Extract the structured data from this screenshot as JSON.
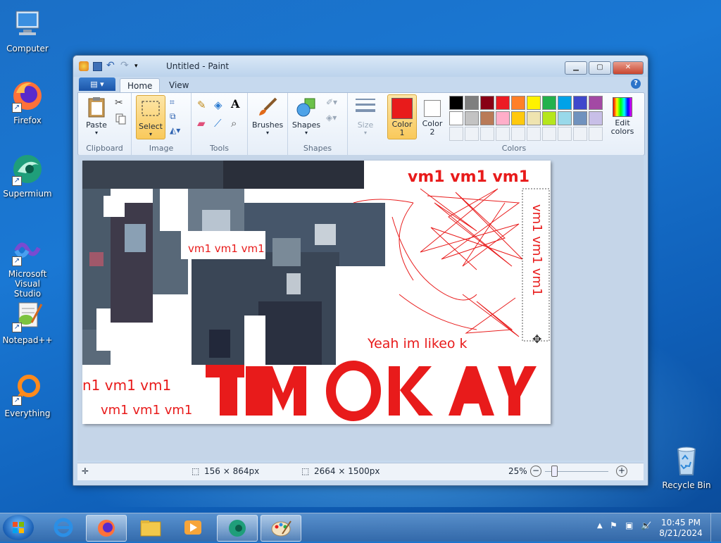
{
  "desktop": {
    "icons": [
      {
        "label": "Computer"
      },
      {
        "label": "Firefox"
      },
      {
        "label": "Supermium"
      },
      {
        "label": "Microsoft Visual Studio"
      },
      {
        "label": "Notepad++"
      },
      {
        "label": "Everything"
      },
      {
        "label": "Recycle Bin"
      }
    ]
  },
  "window": {
    "title": "Untitled - Paint",
    "tabs": {
      "home": "Home",
      "view": "View"
    },
    "help": "?"
  },
  "ribbon": {
    "clipboard": {
      "label": "Clipboard",
      "paste": "Paste"
    },
    "image": {
      "label": "Image",
      "select": "Select"
    },
    "tools": {
      "label": "Tools"
    },
    "brushes": "Brushes",
    "shapes": {
      "label": "Shapes",
      "shapes_btn": "Shapes"
    },
    "size": "Size",
    "colors": {
      "label": "Colors",
      "color1": "Color\n1",
      "color2": "Color\n2",
      "edit": "Edit\ncolors",
      "color1_value": "#e81b1b",
      "color2_value": "#ffffff",
      "palette_row1": [
        "#000000",
        "#7f7f7f",
        "#880015",
        "#ed1c24",
        "#ff7f27",
        "#fff200",
        "#22b14c",
        "#00a2e8",
        "#3f48cc",
        "#a349a4"
      ],
      "palette_row2": [
        "#ffffff",
        "#c3c3c3",
        "#b97a57",
        "#ffaec9",
        "#ffc90e",
        "#efe4b0",
        "#b5e61d",
        "#99d9ea",
        "#7092be",
        "#c8bfe7"
      ]
    }
  },
  "canvas": {
    "texts": {
      "vm_top": "vm1 vm1 vm1",
      "vm_mid": "vm1 vm1 vm1",
      "vm_vertical": "vm1 vm1 vm1",
      "yeah": "Yeah im likeo k",
      "vm_left1": "n1 vm1 vm1",
      "vm_left2": "vm1 vm1 vm1",
      "big": "IM OKAY"
    }
  },
  "status": {
    "selection": "156 × 864px",
    "image_size": "2664 × 1500px",
    "zoom": "25%"
  },
  "taskbar": {
    "time": "10:45 PM",
    "date": "8/21/2024"
  }
}
